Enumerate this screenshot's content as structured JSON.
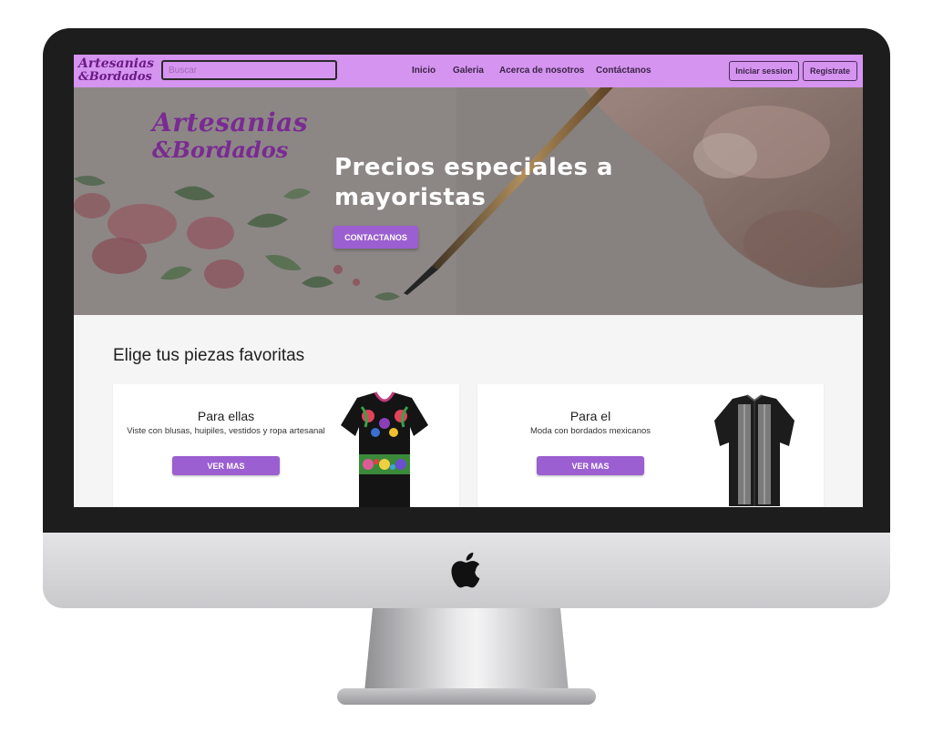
{
  "navbar": {
    "logo_line1": "Artesanias",
    "logo_line2": "&Bordados",
    "search_placeholder": "Buscar",
    "links": [
      "Inicio",
      "Galeria",
      "Acerca de nosotros",
      "Contáctanos"
    ],
    "login_label": "Iniciar session",
    "register_label": "Registrate",
    "background_color": "#d594ef"
  },
  "hero": {
    "logo_line1": "Artesanias",
    "logo_line2": "&Bordados",
    "title": "Precios especiales a mayoristas",
    "button_label": "CONTACTANOS"
  },
  "products": {
    "section_title": "Elige tus piezas favoritas",
    "cards": [
      {
        "title": "Para ellas",
        "subtitle": "Viste con blusas, huipiles, vestidos y ropa artesanal",
        "button_label": "VER MAS"
      },
      {
        "title": "Para el",
        "subtitle": "Moda con bordados mexicanos",
        "button_label": "VER MAS"
      }
    ]
  },
  "colors": {
    "accent_purple": "#9b5fd1",
    "logo_purple": "#7a2a92"
  },
  "icons": {
    "device_logo": "apple-logo-icon"
  }
}
